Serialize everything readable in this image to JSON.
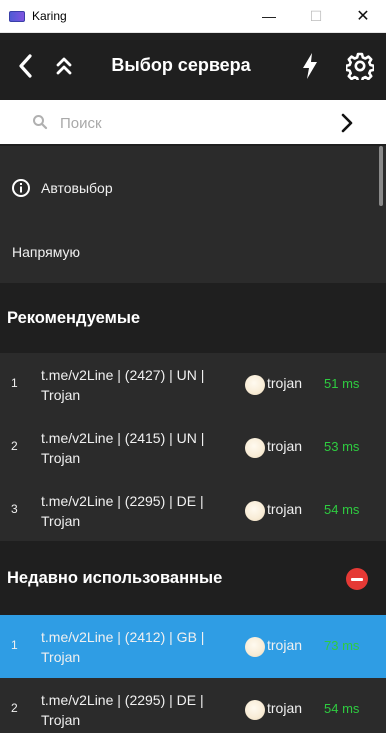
{
  "window": {
    "title": "Karing",
    "controls": {
      "minimize": "—",
      "maximize": "☐",
      "close": "✕"
    }
  },
  "header": {
    "title": "Выбор сервера"
  },
  "search": {
    "placeholder": "Поиск",
    "value": ""
  },
  "top_items": {
    "auto_select": "Автовыбор",
    "direct": "Напрямую"
  },
  "sections": {
    "recommended": "Рекомендуемые",
    "recent": "Недавно использованные"
  },
  "recommended": [
    {
      "index": "1",
      "name": "t.me/v2Line | (2427) | UN | Trojan",
      "protocol": "trojan",
      "ping": "51 ms"
    },
    {
      "index": "2",
      "name": "t.me/v2Line | (2415) | UN | Trojan",
      "protocol": "trojan",
      "ping": "53 ms"
    },
    {
      "index": "3",
      "name": "t.me/v2Line | (2295) | DE | Trojan",
      "protocol": "trojan",
      "ping": "54 ms"
    }
  ],
  "recent": [
    {
      "index": "1",
      "name": "t.me/v2Line | (2412) | GB | Trojan",
      "protocol": "trojan",
      "ping": "73 ms",
      "selected": true
    },
    {
      "index": "2",
      "name": "t.me/v2Line | (2295) | DE | Trojan",
      "protocol": "trojan",
      "ping": "54 ms"
    }
  ],
  "colors": {
    "selected": "#2f9de4",
    "ping": "#2ecc40",
    "remove": "#e53935",
    "header_bg": "#1f1f1f",
    "list_bg": "#2b2b2b"
  }
}
